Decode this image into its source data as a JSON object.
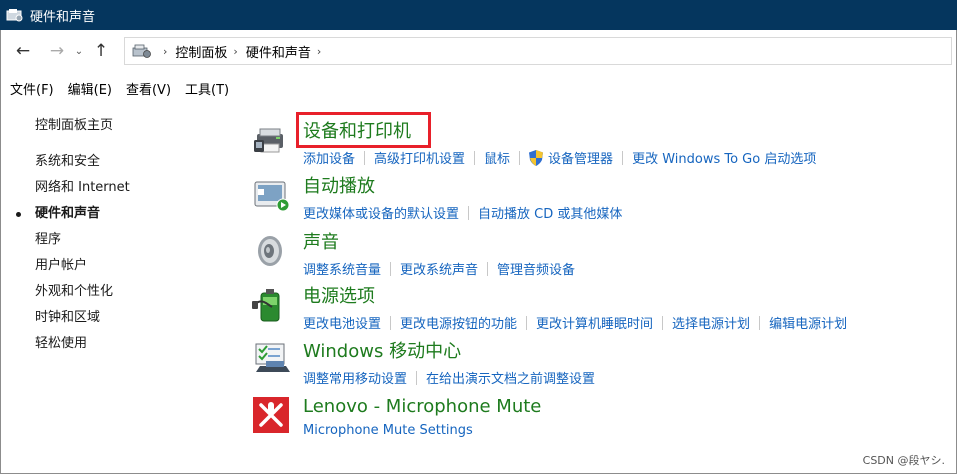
{
  "window": {
    "title": "硬件和声音"
  },
  "nav": {
    "back": "←",
    "forward": "→",
    "recent": "⌄",
    "up": "↑",
    "breadcrumbs": [
      "控制面板",
      "硬件和声音"
    ],
    "separator": "›"
  },
  "menu": [
    "文件(F)",
    "编辑(E)",
    "查看(V)",
    "工具(T)"
  ],
  "sidebar": {
    "home": "控制面板主页",
    "items": [
      "系统和安全",
      "网络和 Internet",
      "硬件和声音",
      "程序",
      "用户帐户",
      "外观和个性化",
      "时钟和区域",
      "轻松使用"
    ],
    "active_index": 2
  },
  "categories": [
    {
      "title": "设备和打印机",
      "icon": "printer-icon",
      "links": [
        "添加设备",
        "高级打印机设置",
        "鼠标",
        "设备管理器",
        "更改 Windows To Go 启动选项"
      ]
    },
    {
      "title": "自动播放",
      "icon": "autoplay-icon",
      "links": [
        "更改媒体或设备的默认设置",
        "自动播放 CD 或其他媒体"
      ]
    },
    {
      "title": "声音",
      "icon": "speaker-icon",
      "links": [
        "调整系统音量",
        "更改系统声音",
        "管理音频设备"
      ]
    },
    {
      "title": "电源选项",
      "icon": "battery-icon",
      "links": [
        "更改电池设置",
        "更改电源按钮的功能",
        "更改计算机睡眠时间",
        "选择电源计划",
        "编辑电源计划"
      ]
    },
    {
      "title": "Windows 移动中心",
      "icon": "mobility-center-icon",
      "links": [
        "调整常用移动设置",
        "在给出演示文档之前调整设置"
      ]
    },
    {
      "title": "Lenovo - Microphone Mute",
      "icon": "microphone-mute-icon",
      "links": [
        "Microphone Mute Settings"
      ]
    }
  ],
  "colors": {
    "titlebar": "#05365e",
    "category_title": "#1e7b1e",
    "link": "#1665bf",
    "highlight": "#e8202a"
  },
  "watermark": "CSDN @段ヤシ."
}
